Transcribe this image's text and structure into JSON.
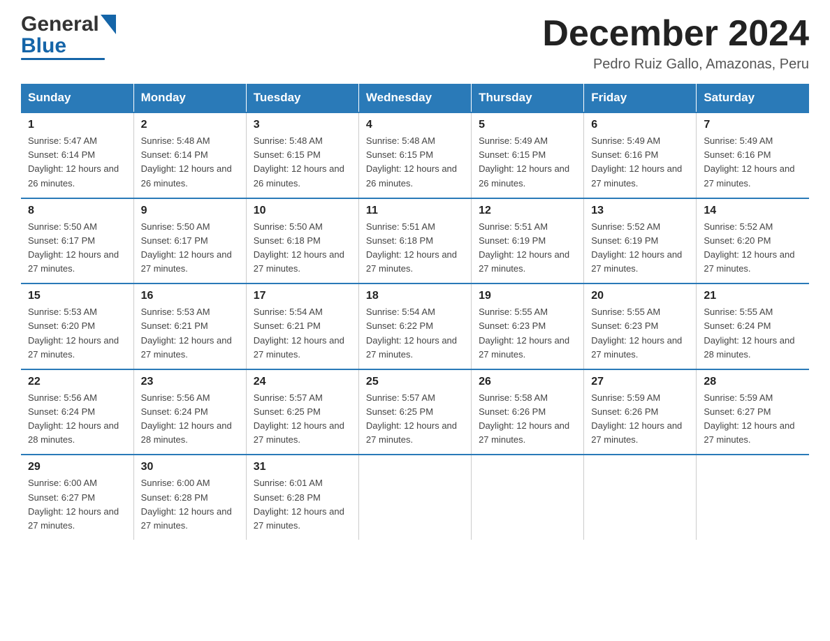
{
  "header": {
    "logo_text_general": "General",
    "logo_text_blue": "Blue",
    "month_title": "December 2024",
    "subtitle": "Pedro Ruiz Gallo, Amazonas, Peru"
  },
  "days_of_week": [
    "Sunday",
    "Monday",
    "Tuesday",
    "Wednesday",
    "Thursday",
    "Friday",
    "Saturday"
  ],
  "weeks": [
    [
      {
        "day": "1",
        "sunrise": "5:47 AM",
        "sunset": "6:14 PM",
        "daylight": "12 hours and 26 minutes."
      },
      {
        "day": "2",
        "sunrise": "5:48 AM",
        "sunset": "6:14 PM",
        "daylight": "12 hours and 26 minutes."
      },
      {
        "day": "3",
        "sunrise": "5:48 AM",
        "sunset": "6:15 PM",
        "daylight": "12 hours and 26 minutes."
      },
      {
        "day": "4",
        "sunrise": "5:48 AM",
        "sunset": "6:15 PM",
        "daylight": "12 hours and 26 minutes."
      },
      {
        "day": "5",
        "sunrise": "5:49 AM",
        "sunset": "6:15 PM",
        "daylight": "12 hours and 26 minutes."
      },
      {
        "day": "6",
        "sunrise": "5:49 AM",
        "sunset": "6:16 PM",
        "daylight": "12 hours and 27 minutes."
      },
      {
        "day": "7",
        "sunrise": "5:49 AM",
        "sunset": "6:16 PM",
        "daylight": "12 hours and 27 minutes."
      }
    ],
    [
      {
        "day": "8",
        "sunrise": "5:50 AM",
        "sunset": "6:17 PM",
        "daylight": "12 hours and 27 minutes."
      },
      {
        "day": "9",
        "sunrise": "5:50 AM",
        "sunset": "6:17 PM",
        "daylight": "12 hours and 27 minutes."
      },
      {
        "day": "10",
        "sunrise": "5:50 AM",
        "sunset": "6:18 PM",
        "daylight": "12 hours and 27 minutes."
      },
      {
        "day": "11",
        "sunrise": "5:51 AM",
        "sunset": "6:18 PM",
        "daylight": "12 hours and 27 minutes."
      },
      {
        "day": "12",
        "sunrise": "5:51 AM",
        "sunset": "6:19 PM",
        "daylight": "12 hours and 27 minutes."
      },
      {
        "day": "13",
        "sunrise": "5:52 AM",
        "sunset": "6:19 PM",
        "daylight": "12 hours and 27 minutes."
      },
      {
        "day": "14",
        "sunrise": "5:52 AM",
        "sunset": "6:20 PM",
        "daylight": "12 hours and 27 minutes."
      }
    ],
    [
      {
        "day": "15",
        "sunrise": "5:53 AM",
        "sunset": "6:20 PM",
        "daylight": "12 hours and 27 minutes."
      },
      {
        "day": "16",
        "sunrise": "5:53 AM",
        "sunset": "6:21 PM",
        "daylight": "12 hours and 27 minutes."
      },
      {
        "day": "17",
        "sunrise": "5:54 AM",
        "sunset": "6:21 PM",
        "daylight": "12 hours and 27 minutes."
      },
      {
        "day": "18",
        "sunrise": "5:54 AM",
        "sunset": "6:22 PM",
        "daylight": "12 hours and 27 minutes."
      },
      {
        "day": "19",
        "sunrise": "5:55 AM",
        "sunset": "6:23 PM",
        "daylight": "12 hours and 27 minutes."
      },
      {
        "day": "20",
        "sunrise": "5:55 AM",
        "sunset": "6:23 PM",
        "daylight": "12 hours and 27 minutes."
      },
      {
        "day": "21",
        "sunrise": "5:55 AM",
        "sunset": "6:24 PM",
        "daylight": "12 hours and 28 minutes."
      }
    ],
    [
      {
        "day": "22",
        "sunrise": "5:56 AM",
        "sunset": "6:24 PM",
        "daylight": "12 hours and 28 minutes."
      },
      {
        "day": "23",
        "sunrise": "5:56 AM",
        "sunset": "6:24 PM",
        "daylight": "12 hours and 28 minutes."
      },
      {
        "day": "24",
        "sunrise": "5:57 AM",
        "sunset": "6:25 PM",
        "daylight": "12 hours and 27 minutes."
      },
      {
        "day": "25",
        "sunrise": "5:57 AM",
        "sunset": "6:25 PM",
        "daylight": "12 hours and 27 minutes."
      },
      {
        "day": "26",
        "sunrise": "5:58 AM",
        "sunset": "6:26 PM",
        "daylight": "12 hours and 27 minutes."
      },
      {
        "day": "27",
        "sunrise": "5:59 AM",
        "sunset": "6:26 PM",
        "daylight": "12 hours and 27 minutes."
      },
      {
        "day": "28",
        "sunrise": "5:59 AM",
        "sunset": "6:27 PM",
        "daylight": "12 hours and 27 minutes."
      }
    ],
    [
      {
        "day": "29",
        "sunrise": "6:00 AM",
        "sunset": "6:27 PM",
        "daylight": "12 hours and 27 minutes."
      },
      {
        "day": "30",
        "sunrise": "6:00 AM",
        "sunset": "6:28 PM",
        "daylight": "12 hours and 27 minutes."
      },
      {
        "day": "31",
        "sunrise": "6:01 AM",
        "sunset": "6:28 PM",
        "daylight": "12 hours and 27 minutes."
      },
      {
        "day": "",
        "sunrise": "",
        "sunset": "",
        "daylight": ""
      },
      {
        "day": "",
        "sunrise": "",
        "sunset": "",
        "daylight": ""
      },
      {
        "day": "",
        "sunrise": "",
        "sunset": "",
        "daylight": ""
      },
      {
        "day": "",
        "sunrise": "",
        "sunset": "",
        "daylight": ""
      }
    ]
  ],
  "labels": {
    "sunrise": "Sunrise: ",
    "sunset": "Sunset: ",
    "daylight": "Daylight: "
  }
}
